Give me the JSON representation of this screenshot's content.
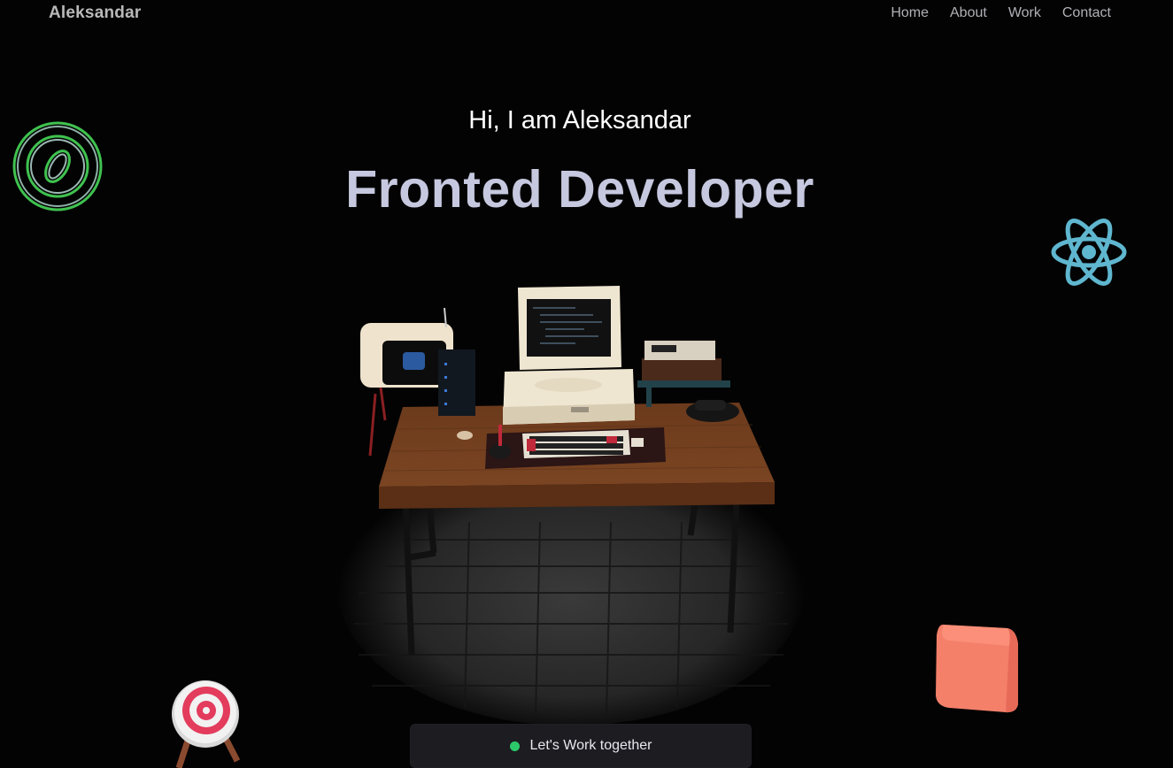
{
  "header": {
    "brand": "Aleksandar",
    "nav": [
      "Home",
      "About",
      "Work",
      "Contact"
    ]
  },
  "hero": {
    "greeting": "Hi, I am Aleksandar",
    "headline": "Fronted Developer"
  },
  "cta": {
    "label": "Let's Work together",
    "status_color": "#2cc96a"
  },
  "colors": {
    "background": "#030303",
    "headline": "#c6c8df",
    "accent_green": "#2cc96a",
    "react_blue": "#5fb6cf",
    "cube": "#f4806a"
  },
  "floating_icons": [
    "vue-rings-icon",
    "react-atom-icon",
    "target-icon",
    "cube-icon"
  ],
  "scene": "desk-with-computer-3d"
}
